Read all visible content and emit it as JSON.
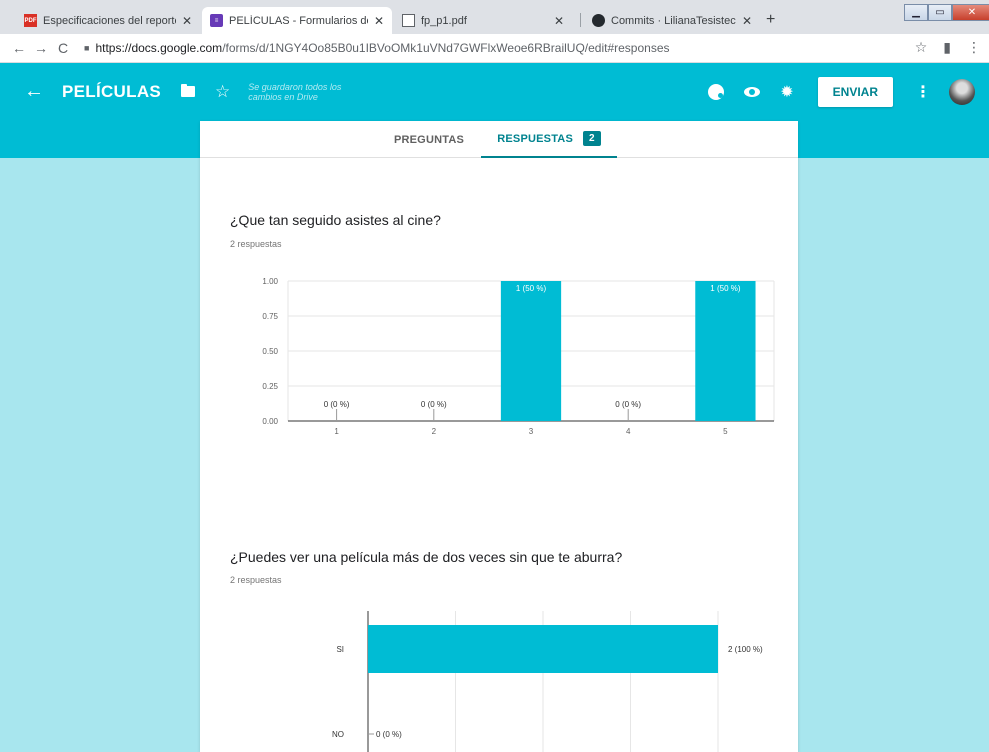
{
  "browser": {
    "tabs": [
      {
        "title": "Especificaciones del reporte de la",
        "favicon_color": "#d93025",
        "favicon_text": "PDF",
        "active": false
      },
      {
        "title": "PELÍCULAS - Formularios de Goo",
        "favicon_color": "#673ab7",
        "favicon_text": "",
        "active": true
      },
      {
        "title": "fp_p1.pdf",
        "favicon_color": "",
        "favicon_text": "",
        "active": false
      },
      {
        "title": "Commits · LilianaTesisteco/Repo",
        "favicon_color": "#24292e",
        "favicon_text": "",
        "active": false
      }
    ],
    "new_tab": "+",
    "url_host": "https://docs.google.com",
    "url_path": "/forms/d/1NGY4Oo85B0u1IBVoOMk1uVNd7GWFlxWeoe6RBrailUQ/edit#responses"
  },
  "header": {
    "title": "PELÍCULAS",
    "saved_status": "Se guardaron todos los cambios en Drive",
    "send_label": "ENVIAR"
  },
  "tabs": {
    "questions_label": "PREGUNTAS",
    "responses_label": "RESPUESTAS",
    "responses_count": "2"
  },
  "questions": [
    {
      "title": "¿Que tan seguido asistes al cine?",
      "response_count": "2 respuestas"
    },
    {
      "title": "¿Puedes ver una película más de dos veces sin que te aburra?",
      "response_count": "2 respuestas"
    }
  ],
  "colors": {
    "accent": "#00bcd4",
    "dark_accent": "#00838f",
    "background": "#a8e6ee",
    "bar": "#00bcd4"
  },
  "chart_data": [
    {
      "type": "bar",
      "categories": [
        "1",
        "2",
        "3",
        "4",
        "5"
      ],
      "values": [
        0,
        0,
        1,
        0,
        1
      ],
      "data_labels": [
        "0 (0 %)",
        "0 (0 %)",
        "1 (50 %)",
        "0 (0 %)",
        "1 (50 %)"
      ],
      "yticks": [
        "0.00",
        "0.25",
        "0.50",
        "0.75",
        "1.00"
      ],
      "ylim": [
        0,
        1
      ],
      "grid": true
    },
    {
      "type": "bar",
      "orientation": "horizontal",
      "categories": [
        "SI",
        "NO"
      ],
      "values": [
        2,
        0
      ],
      "data_labels": [
        "2 (100 %)",
        "0 (0 %)"
      ],
      "xlim": [
        0,
        2
      ],
      "grid": true
    }
  ]
}
